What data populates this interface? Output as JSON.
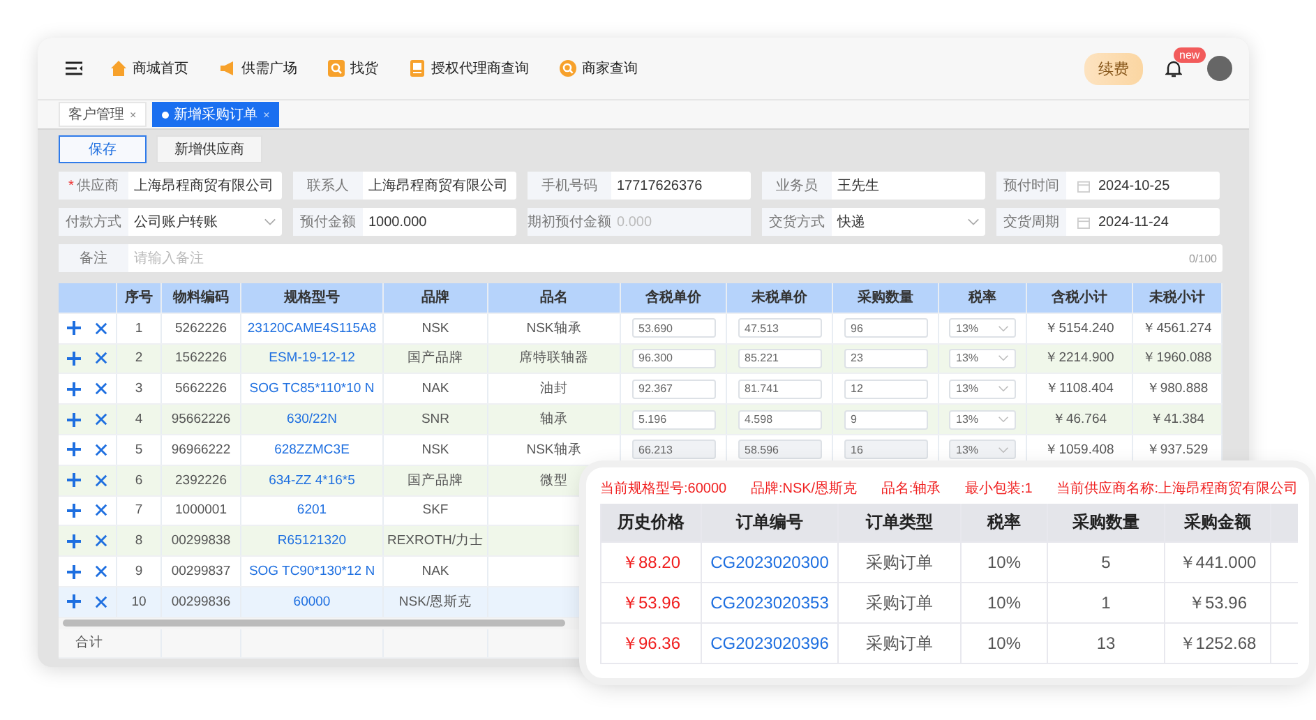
{
  "nav": {
    "items": [
      {
        "label": "商城首页"
      },
      {
        "label": "供需广场"
      },
      {
        "label": "找货"
      },
      {
        "label": "授权代理商查询"
      },
      {
        "label": "商家查询"
      }
    ],
    "renew": "续费",
    "badge": "new"
  },
  "tabs": [
    {
      "label": "客户管理",
      "close": "×",
      "selected": false
    },
    {
      "label": "新增采购订单",
      "close": "×",
      "selected": true
    }
  ],
  "buttons": [
    {
      "label": "保存",
      "primary": true
    },
    {
      "label": "新增供应商",
      "primary": false
    }
  ],
  "form": {
    "rows": [
      [
        {
          "label": "供应商",
          "value": "上海昂程商贸有限公司",
          "kind": "text",
          "required_mark": "*",
          "disabled": false
        },
        {
          "label": "联系人",
          "value": "上海昂程商贸有限公司",
          "kind": "text",
          "disabled": false
        },
        {
          "label": "手机号码",
          "value": "17717626376",
          "kind": "text",
          "disabled": false
        },
        {
          "label": "业务员",
          "value": "王先生",
          "kind": "text",
          "disabled": false
        },
        {
          "label": "预付时间",
          "value": "2024-10-25",
          "kind": "date",
          "disabled": false
        }
      ],
      [
        {
          "label": "付款方式",
          "value": "公司账户转账",
          "kind": "select",
          "disabled": false
        },
        {
          "label": "预付金额",
          "value": "1000.000",
          "kind": "text",
          "disabled": false
        },
        {
          "label": "期初预付金额",
          "value": "0.000",
          "kind": "text",
          "disabled": true
        },
        {
          "label": "交货方式",
          "value": "快递",
          "kind": "select",
          "disabled": false
        },
        {
          "label": "交货周期",
          "value": "2024-11-24",
          "kind": "date",
          "disabled": false
        }
      ]
    ],
    "note": {
      "label": "备注",
      "placeholder": "请输入备注",
      "counter": "0/100"
    }
  },
  "table": {
    "columns": [
      "序号",
      "物料编码",
      "规格型号",
      "品牌",
      "品名",
      "含税单价",
      "未税单价",
      "采购数量",
      "税率",
      "含税小计",
      "未税小计"
    ],
    "rows": [
      {
        "no": "1",
        "code": "5262226",
        "spec": "23120CAME4S115A8",
        "brand": "NSK",
        "name": "NSK轴承",
        "price_tax": "53.690",
        "price": "47.513",
        "qty": "96",
        "rate": "13%",
        "sub_tax": "￥5154.240",
        "sub": "￥4561.274",
        "disabled": false,
        "selected": false
      },
      {
        "no": "2",
        "code": "1562226",
        "spec": "ESM-19-12-12",
        "brand": "国产品牌",
        "name": "席特联轴器",
        "price_tax": "96.300",
        "price": "85.221",
        "qty": "23",
        "rate": "13%",
        "sub_tax": "￥2214.900",
        "sub": "￥1960.088",
        "disabled": false,
        "selected": false
      },
      {
        "no": "3",
        "code": "5662226",
        "spec": "SOG TC85*110*10 N",
        "brand": "NAK",
        "name": "油封",
        "price_tax": "92.367",
        "price": "81.741",
        "qty": "12",
        "rate": "13%",
        "sub_tax": "￥1108.404",
        "sub": "￥980.888",
        "disabled": false,
        "selected": false
      },
      {
        "no": "4",
        "code": "95662226",
        "spec": "630/22N",
        "brand": "SNR",
        "name": "轴承",
        "price_tax": "5.196",
        "price": "4.598",
        "qty": "9",
        "rate": "13%",
        "sub_tax": "￥46.764",
        "sub": "￥41.384",
        "disabled": false,
        "selected": false
      },
      {
        "no": "5",
        "code": "96966222",
        "spec": "628ZZMC3E",
        "brand": "NSK",
        "name": "NSK轴承",
        "price_tax": "66.213",
        "price": "58.596",
        "qty": "16",
        "rate": "13%",
        "sub_tax": "￥1059.408",
        "sub": "￥937.529",
        "disabled": true,
        "selected": false
      },
      {
        "no": "6",
        "code": "2392226",
        "spec": "634-ZZ 4*16*5",
        "brand": "国产品牌",
        "name": "微型",
        "selected": false
      },
      {
        "no": "7",
        "code": "1000001",
        "spec": "6201",
        "brand": "SKF",
        "selected": false
      },
      {
        "no": "8",
        "code": "00299838",
        "spec": "R65121320",
        "brand": "REXROTH/力士",
        "selected": false
      },
      {
        "no": "9",
        "code": "00299837",
        "spec": "SOG TC90*130*12 N",
        "brand": "NAK",
        "selected": false
      },
      {
        "no": "10",
        "code": "00299836",
        "spec": "60000",
        "brand": "NSK/恩斯克",
        "selected": true
      }
    ],
    "total_label": "合计"
  },
  "popup": {
    "info": [
      "当前规格型号:60000",
      "品牌:NSK/恩斯克",
      "品名:轴承",
      "最小包装:1",
      "当前供应商名称:上海昂程商贸有限公司"
    ],
    "columns": [
      "历史价格",
      "订单编号",
      "订单类型",
      "税率",
      "采购数量",
      "采购金额"
    ],
    "rows": [
      {
        "price": "￥88.20",
        "order": "CG2023020300",
        "type": "采购订单",
        "rate": "10%",
        "qty": "5",
        "amount": "￥441.000"
      },
      {
        "price": "￥53.96",
        "order": "CG2023020353",
        "type": "采购订单",
        "rate": "10%",
        "qty": "1",
        "amount": "￥53.96"
      },
      {
        "price": "￥96.36",
        "order": "CG2023020396",
        "type": "采购订单",
        "rate": "10%",
        "qty": "13",
        "amount": "￥1252.68"
      }
    ]
  }
}
